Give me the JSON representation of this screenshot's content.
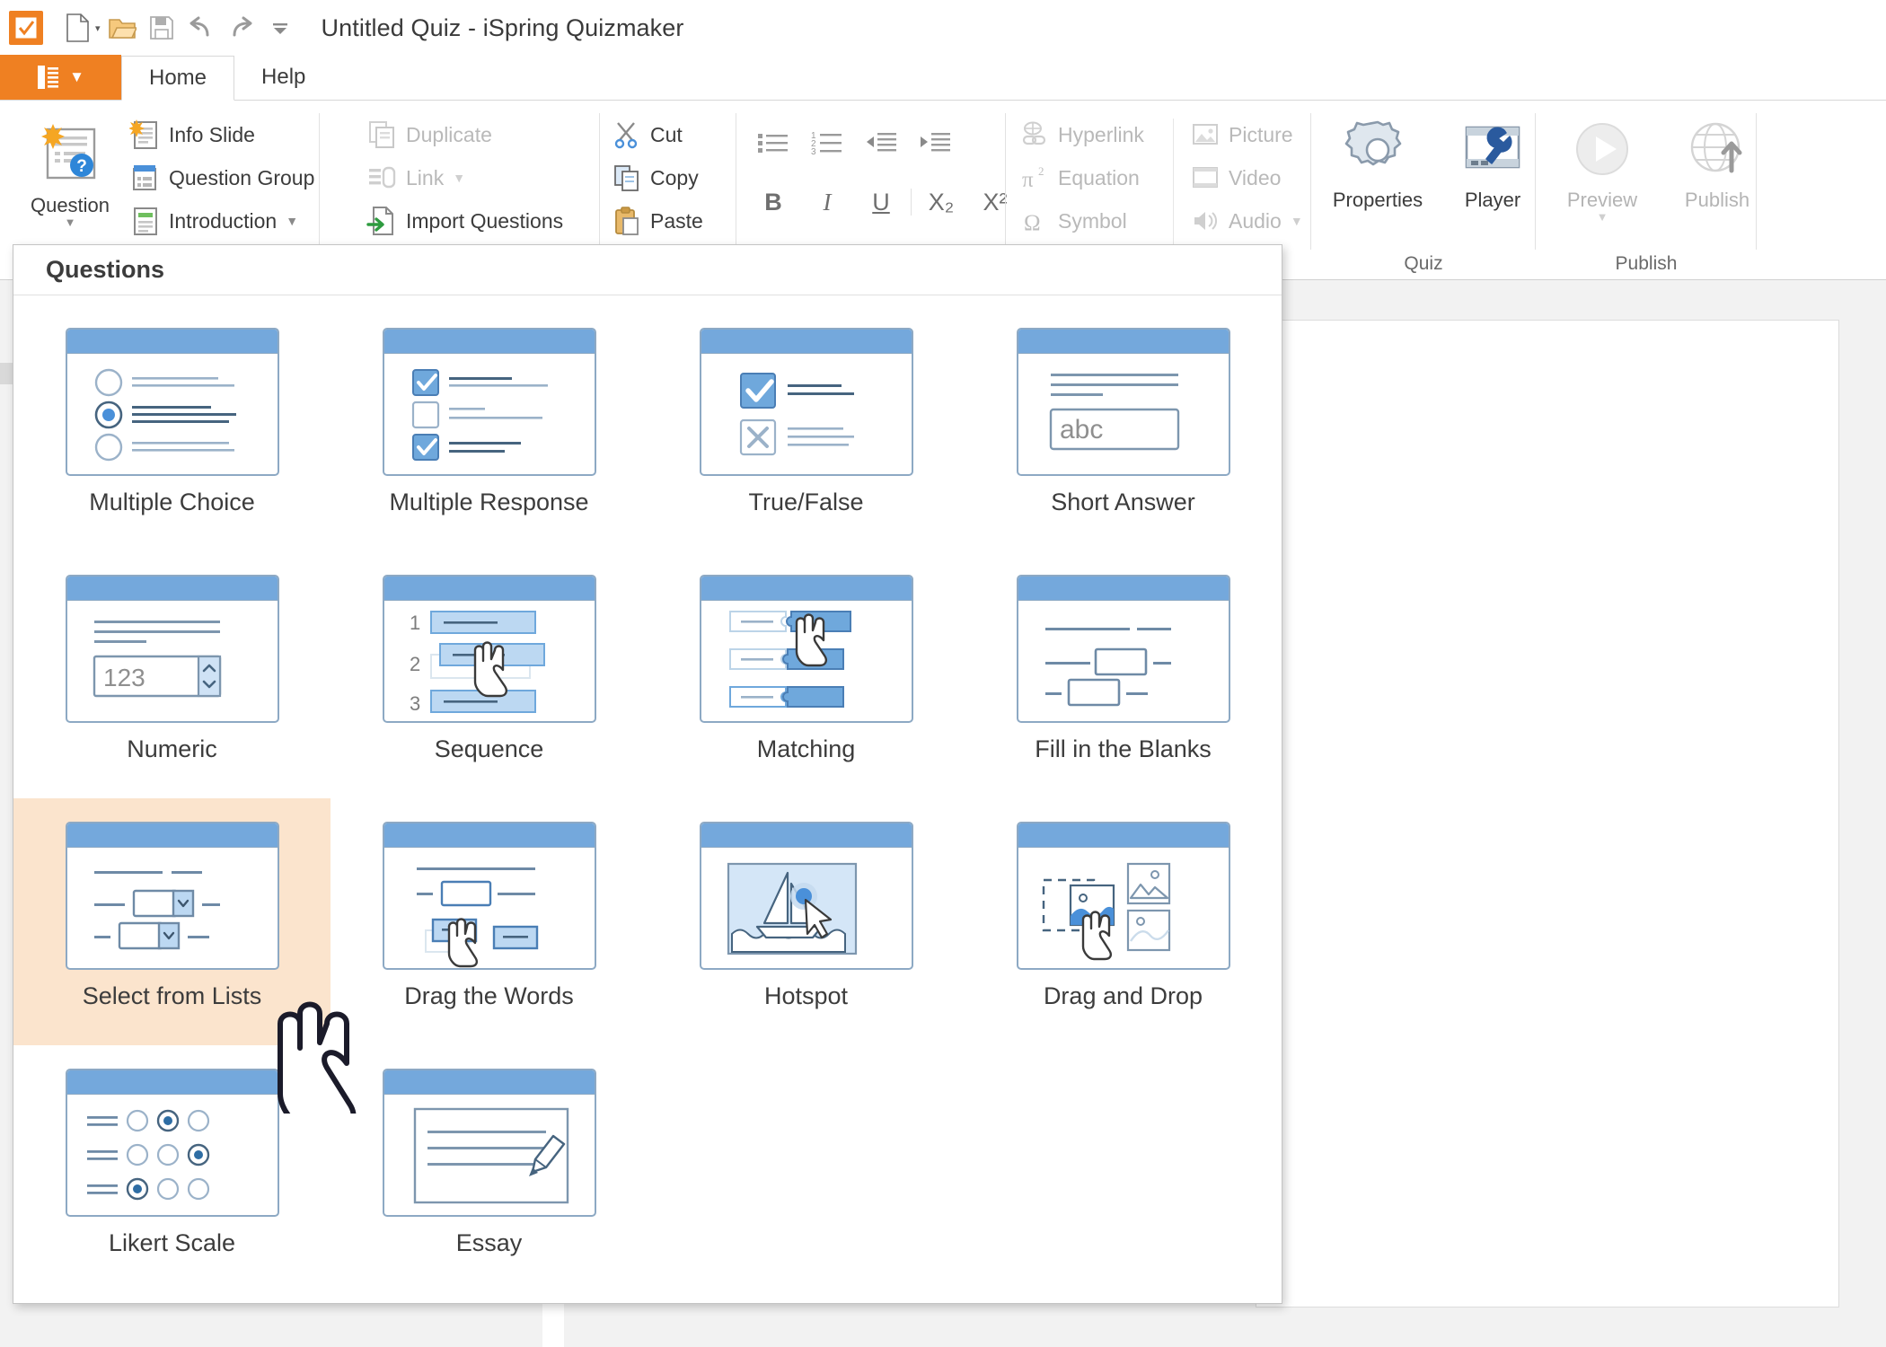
{
  "window": {
    "title": "Untitled Quiz - iSpring Quizmaker",
    "app_icon": "checkbox-icon"
  },
  "quick_access": [
    {
      "name": "new-document",
      "icon": "new-file-icon",
      "has_caret": true
    },
    {
      "name": "open-document",
      "icon": "open-folder-icon",
      "has_caret": false
    },
    {
      "name": "save-document",
      "icon": "save-disk-icon",
      "has_caret": false
    },
    {
      "name": "undo",
      "icon": "undo-arrow-icon",
      "has_caret": false
    },
    {
      "name": "redo",
      "icon": "redo-arrow-icon",
      "has_caret": false
    },
    {
      "name": "customize-toolbar",
      "icon": "chevron-down-icon",
      "has_caret": false
    }
  ],
  "tabs": {
    "file_menu_label": "",
    "items": [
      {
        "label": "Home",
        "active": true
      },
      {
        "label": "Help",
        "active": false
      }
    ]
  },
  "ribbon": {
    "groups": [
      {
        "name": "insert",
        "label": "",
        "big_button": {
          "label": "Question",
          "icon": "question-slide-icon",
          "has_caret": true
        },
        "small_buttons": [
          {
            "label": "Info Slide",
            "icon": "info-slide-icon",
            "disabled": false,
            "caret": false
          },
          {
            "label": "Question Group",
            "icon": "question-group-icon",
            "disabled": false,
            "caret": false
          },
          {
            "label": "Introduction",
            "icon": "introduction-icon",
            "disabled": false,
            "caret": true
          }
        ]
      },
      {
        "name": "edit",
        "label": "",
        "small_buttons": [
          {
            "label": "Duplicate",
            "icon": "duplicate-icon",
            "disabled": true,
            "caret": false
          },
          {
            "label": "Link",
            "icon": "link-icon",
            "disabled": true,
            "caret": true
          },
          {
            "label": "Import Questions",
            "icon": "import-questions-icon",
            "disabled": false,
            "caret": false
          }
        ]
      },
      {
        "name": "clipboard",
        "label": "",
        "small_buttons": [
          {
            "label": "Cut",
            "icon": "scissors-icon",
            "disabled": false,
            "caret": false
          },
          {
            "label": "Copy",
            "icon": "copy-icon",
            "disabled": false,
            "caret": false
          },
          {
            "label": "Paste",
            "icon": "clipboard-icon",
            "disabled": false,
            "caret": false
          }
        ]
      },
      {
        "name": "formatting",
        "label": "",
        "row1": [
          {
            "name": "bullet-list-icon",
            "glyph": ""
          },
          {
            "name": "numbered-list-icon",
            "glyph": ""
          },
          {
            "name": "decrease-indent-icon",
            "glyph": ""
          },
          {
            "name": "increase-indent-icon",
            "glyph": ""
          }
        ],
        "row2": [
          {
            "name": "bold-button",
            "glyph": "B"
          },
          {
            "name": "italic-button",
            "glyph": "I"
          },
          {
            "name": "underline-button",
            "glyph": "U"
          },
          {
            "name": "subscript-button",
            "glyph": "X₂"
          },
          {
            "name": "superscript-button",
            "glyph": "X²"
          }
        ]
      },
      {
        "name": "insert-media",
        "label": "",
        "col1": [
          {
            "label": "Hyperlink",
            "icon": "hyperlink-icon",
            "disabled": true,
            "caret": false
          },
          {
            "label": "Equation",
            "icon": "equation-icon",
            "disabled": true,
            "caret": false
          },
          {
            "label": "Symbol",
            "icon": "symbol-icon",
            "disabled": true,
            "caret": false
          }
        ],
        "col2": [
          {
            "label": "Picture",
            "icon": "picture-icon",
            "disabled": true,
            "caret": false
          },
          {
            "label": "Video",
            "icon": "video-icon",
            "disabled": true,
            "caret": false
          },
          {
            "label": "Audio",
            "icon": "audio-icon",
            "disabled": true,
            "caret": true
          }
        ]
      },
      {
        "name": "quiz",
        "label": "Quiz",
        "buttons": [
          {
            "label": "Properties",
            "icon": "gear-icon",
            "disabled": false,
            "caret": false
          },
          {
            "label": "Player",
            "icon": "player-wrench-icon",
            "disabled": false,
            "caret": false
          }
        ]
      },
      {
        "name": "publish",
        "label": "Publish",
        "buttons": [
          {
            "label": "Preview",
            "icon": "play-circle-icon",
            "disabled": true,
            "caret": true
          },
          {
            "label": "Publish",
            "icon": "globe-upload-icon",
            "disabled": true,
            "caret": false
          }
        ]
      }
    ]
  },
  "questions_panel": {
    "header": "Questions",
    "items": [
      {
        "label": "Multiple Choice",
        "thumb": "multiple-choice",
        "hover": false
      },
      {
        "label": "Multiple Response",
        "thumb": "multiple-response",
        "hover": false
      },
      {
        "label": "True/False",
        "thumb": "true-false",
        "hover": false
      },
      {
        "label": "Short Answer",
        "thumb": "short-answer",
        "hover": false,
        "sample_text": "abc"
      },
      {
        "label": "Numeric",
        "thumb": "numeric",
        "hover": false,
        "sample_text": "123"
      },
      {
        "label": "Sequence",
        "thumb": "sequence",
        "hover": false,
        "numbers": [
          "1",
          "2",
          "3"
        ]
      },
      {
        "label": "Matching",
        "thumb": "matching",
        "hover": false
      },
      {
        "label": "Fill in the Blanks",
        "thumb": "fill-in-the-blanks",
        "hover": false
      },
      {
        "label": "Select from Lists",
        "thumb": "select-from-lists",
        "hover": true
      },
      {
        "label": "Drag the Words",
        "thumb": "drag-the-words",
        "hover": false
      },
      {
        "label": "Hotspot",
        "thumb": "hotspot",
        "hover": false
      },
      {
        "label": "Drag and Drop",
        "thumb": "drag-and-drop",
        "hover": false
      },
      {
        "label": "Likert Scale",
        "thumb": "likert-scale",
        "hover": false
      },
      {
        "label": "Essay",
        "thumb": "essay",
        "hover": false
      }
    ]
  },
  "colors": {
    "brand_orange": "#ef8022",
    "thumb_blue": "#74a8dc",
    "thumb_border": "#8da9c4",
    "hover_peach": "#fbe4cd",
    "workspace_gray": "#f2f2f2",
    "text_dark": "#3c3c3c",
    "text_disabled": "#b9b9b9"
  }
}
